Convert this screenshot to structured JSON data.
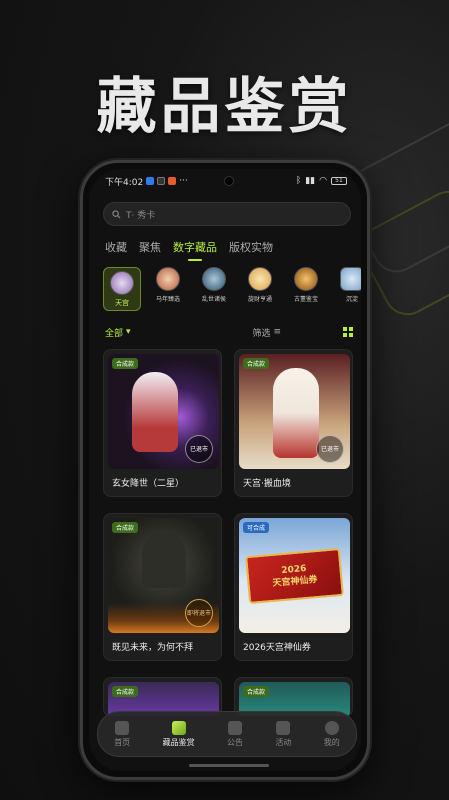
{
  "promo": {
    "title": "藏品鉴赏"
  },
  "status": {
    "time": "下午4:02",
    "signal_text": "51"
  },
  "search": {
    "placeholder": "T· 秀卡"
  },
  "tabs": [
    {
      "label": "收藏",
      "active": false
    },
    {
      "label": "聚焦",
      "active": false
    },
    {
      "label": "数字藏品",
      "active": true
    },
    {
      "label": "版权实物",
      "active": false
    }
  ],
  "categories": [
    {
      "label": "天宫",
      "active": true,
      "color": "#b9a7c9"
    },
    {
      "label": "马年臻选",
      "active": false,
      "color": "#b55b3a"
    },
    {
      "label": "乱世诸侯",
      "active": false,
      "color": "#4a7a9a"
    },
    {
      "label": "旋财亨通",
      "active": false,
      "color": "#d9a14a"
    },
    {
      "label": "古董鉴宝",
      "active": false,
      "color": "#c77a1e"
    },
    {
      "label": "沉淀",
      "active": false,
      "color": "#7aa3c9"
    }
  ],
  "filters": {
    "all_label": "全部",
    "filter_label": "筛选"
  },
  "cards": [
    {
      "title": "玄女降世（二星）",
      "badge": "合成款",
      "stamp": "已退市"
    },
    {
      "title": "天宫·搬血境",
      "badge": "合成款",
      "stamp": "已退市"
    },
    {
      "title": "既见未来，为何不拜",
      "badge": "合成款",
      "stamp": "即将退市"
    },
    {
      "title": "2026天宫神仙券",
      "badge": "可合成",
      "ticket": "2026\n天宫神仙券"
    },
    {
      "title": "",
      "badge": "合成款"
    },
    {
      "title": "",
      "badge": "合成款"
    }
  ],
  "nav": [
    {
      "label": "首页",
      "active": false
    },
    {
      "label": "藏品鉴赏",
      "active": true
    },
    {
      "label": "公告",
      "active": false
    },
    {
      "label": "活动",
      "active": false
    },
    {
      "label": "我的",
      "active": false
    }
  ],
  "colors": {
    "accent": "#b8ef3e",
    "background": "#141414"
  }
}
